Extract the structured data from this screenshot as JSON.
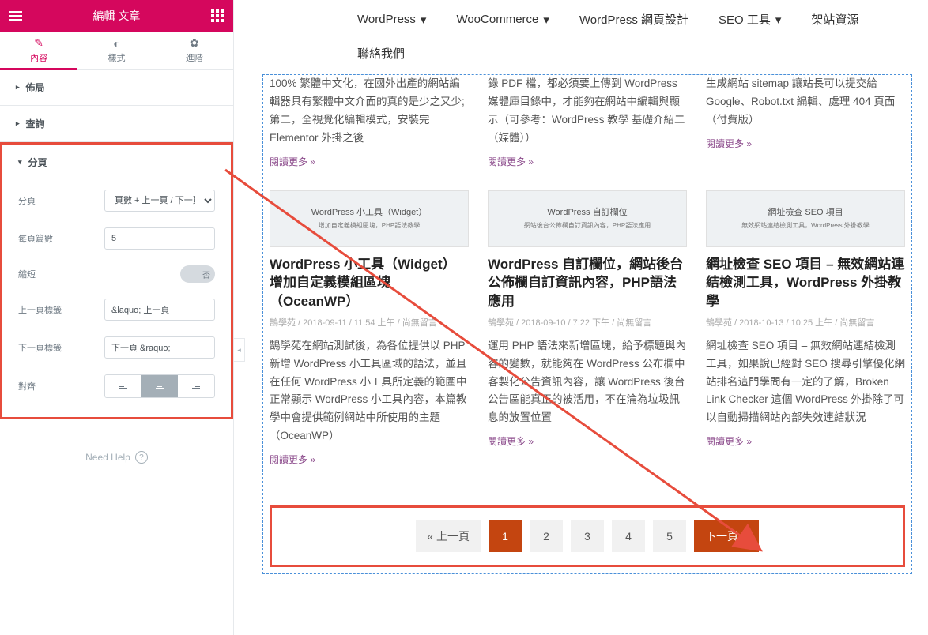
{
  "sidebar": {
    "header_title": "編輯 文章",
    "tabs": {
      "content": "內容",
      "style": "樣式",
      "advanced": "進階"
    },
    "sections": {
      "layout": "佈局",
      "query": "查詢",
      "pagination": "分頁"
    },
    "controls": {
      "pagination_label": "分頁",
      "pagination_value": "頁數 + 上一頁 / 下一頁",
      "per_page_label": "每頁篇數",
      "per_page_value": "5",
      "shorten_label": "縮短",
      "shorten_value": "否",
      "prev_label": "上一頁標籤",
      "prev_value": "&laquo; 上一頁",
      "next_label": "下一頁標籤",
      "next_value": "下一頁 &raquo;",
      "align_label": "對齊"
    },
    "need_help": "Need Help"
  },
  "topnav": {
    "wordpress": "WordPress",
    "woocommerce": "WooCommerce",
    "design": "WordPress 網頁設計",
    "seo": "SEO 工具",
    "resources": "架站資源",
    "contact": "聯絡我們"
  },
  "posts_top": [
    {
      "excerpt": "100% 繁體中文化，在國外出產的網站編輯器具有繁體中文介面的真的是少之又少; 第二，全視覺化編輯模式，安裝完 Elementor 外掛之後",
      "read": "閱讀更多 »"
    },
    {
      "excerpt": "錄 PDF 檔，都必須要上傳到 WordPress 媒體庫目錄中，才能夠在網站中編輯與顯示（可參考：WordPress 教學 基礎介紹二（媒體））",
      "read": "閱讀更多 »"
    },
    {
      "excerpt": "生成網站 sitemap 讓站長可以提交給 Google、Robot.txt 編輯、處理 404 頁面（付費版）",
      "read": "閱讀更多 »"
    }
  ],
  "posts": [
    {
      "img1": "WordPress 小工具（Widget）",
      "img2": "增加自定義模組區塊，PHP語法教學",
      "title": "WordPress 小工具（Widget）增加自定義模組區塊（OceanWP）",
      "meta": "鵠學苑 / 2018-09-11 / 11:54 上午 / 尚無留言",
      "excerpt": "鵠學苑在網站測試後，為各位提供以 PHP 新增 WordPress 小工具區域的語法，並且在任何 WordPress 小工具所定義的範圍中正常顯示 WordPress 小工具內容，本篇教學中會提供範例網站中所使用的主題（OceanWP）",
      "read": "閱讀更多 »"
    },
    {
      "img1": "WordPress 自訂欄位",
      "img2": "網站後台公佈欄自訂資訊內容，PHP語法應用",
      "title": "WordPress 自訂欄位，網站後台公佈欄自訂資訊內容，PHP語法應用",
      "meta": "鵠學苑 / 2018-09-10 / 7:22 下午 / 尚無留言",
      "excerpt": "運用 PHP 語法來新增區塊，給予標題與內容的變數，就能夠在 WordPress 公布欄中客製化公告資訊內容，讓 WordPress 後台公告區能真正的被活用，不在淪為垃圾訊息的放置位置",
      "read": "閱讀更多 »"
    },
    {
      "img1": "網址檢查 SEO 項目",
      "img2": "無效網站連結檢測工具，WordPress 外掛教學",
      "title": "網址檢查 SEO 項目 – 無效網站連結檢測工具，WordPress 外掛教學",
      "meta": "鵠學苑 / 2018-10-13 / 10:25 上午 / 尚無留言",
      "excerpt": "網址檢查 SEO 項目 – 無效網站連結檢測工具，如果說已經對 SEO 搜尋引擎優化網站排名這門學問有一定的了解，Broken Link Checker 這個 WordPress 外掛除了可以自動掃描網站內部失效連結狀況",
      "read": "閱讀更多 »"
    }
  ],
  "pagination": {
    "prev": "« 上一頁",
    "pages": [
      "1",
      "2",
      "3",
      "4",
      "5"
    ],
    "next": "下一頁 »"
  }
}
